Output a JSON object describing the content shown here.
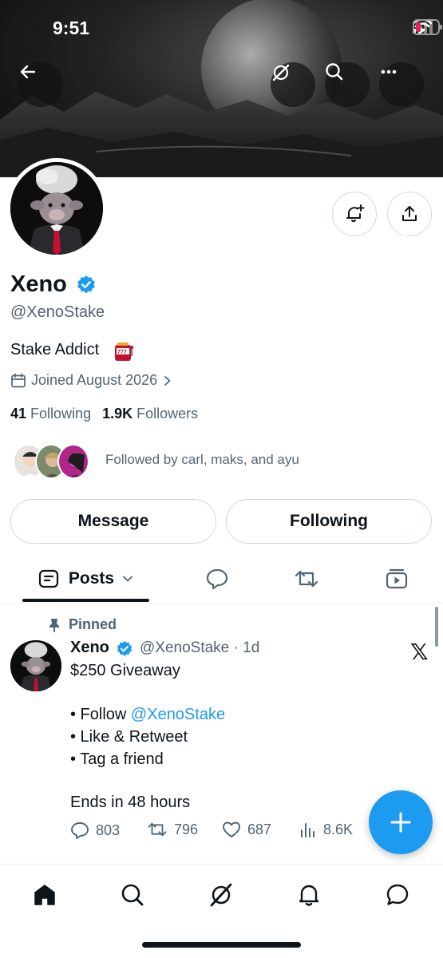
{
  "status_bar": {
    "time": "9:51"
  },
  "profile": {
    "display_name": "Xeno",
    "handle": "@XenoStake",
    "bio": "Stake Addict",
    "joined": "Joined August 2026",
    "following_count": "41",
    "following_label": "Following",
    "followers_count": "1.9K",
    "followers_label": "Followers",
    "followed_by": "Followed by carl, maks, and ayu"
  },
  "buttons": {
    "message": "Message",
    "following": "Following"
  },
  "tabs": {
    "posts": "Posts"
  },
  "post": {
    "pinned_label": "Pinned",
    "author_name": "Xeno",
    "author_handle_time": "@XenoStake · 1d",
    "line1": "$250 Giveaway",
    "line2_prefix": "• Follow ",
    "line2_link": "@XenoStake",
    "line3": "• Like & Retweet",
    "line4": "• Tag a friend",
    "line5": "Ends in 48 hours",
    "replies": "803",
    "reposts": "796",
    "likes": "687",
    "views": "8.6K"
  },
  "colors": {
    "accent": "#1d9bf0",
    "text_primary": "#0f1419",
    "text_secondary": "#536471",
    "battery_low": "#e0245e"
  },
  "icons": [
    "back-arrow-icon",
    "grok-icon",
    "search-icon",
    "more-icon",
    "bell-plus-icon",
    "share-icon",
    "verified-badge-icon",
    "calendar-icon",
    "chevron-right-icon",
    "posts-icon",
    "chevron-down-icon",
    "replies-icon",
    "retweet-icon",
    "video-icon",
    "pin-icon",
    "x-logo-icon",
    "reply-icon",
    "like-icon",
    "views-icon",
    "compose-plus-icon",
    "home-icon",
    "notifications-icon",
    "messages-icon"
  ]
}
